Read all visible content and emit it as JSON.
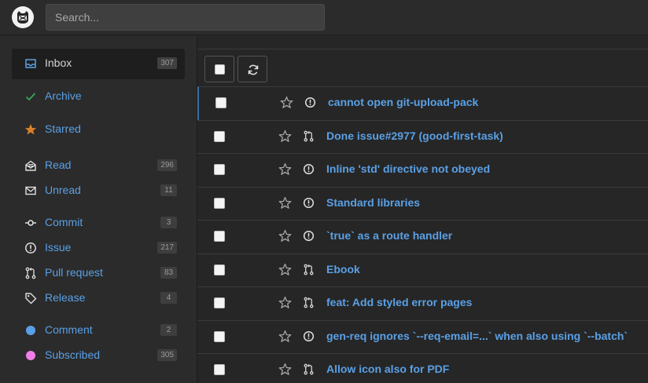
{
  "header": {
    "search_placeholder": "Search..."
  },
  "sidebar": {
    "items": [
      {
        "label": "Inbox",
        "count": "307",
        "icon": "inbox-icon"
      },
      {
        "label": "Archive",
        "count": "",
        "icon": "check-icon"
      },
      {
        "label": "Starred",
        "count": "",
        "icon": "star-icon"
      },
      {
        "label": "Read",
        "count": "296",
        "icon": "envelope-open-icon"
      },
      {
        "label": "Unread",
        "count": "11",
        "icon": "envelope-icon"
      },
      {
        "label": "Commit",
        "count": "3",
        "icon": "commit-icon"
      },
      {
        "label": "Issue",
        "count": "217",
        "icon": "issue-icon"
      },
      {
        "label": "Pull request",
        "count": "83",
        "icon": "pull-request-icon"
      },
      {
        "label": "Release",
        "count": "4",
        "icon": "tag-icon"
      },
      {
        "label": "Comment",
        "count": "2",
        "icon": "comment-dot-icon"
      },
      {
        "label": "Subscribed",
        "count": "305",
        "icon": "subscribed-dot-icon"
      }
    ]
  },
  "colors": {
    "accent": "#5aa0e6",
    "archive_green": "#3aa55a",
    "starred_orange": "#d9822b",
    "comment_blue": "#5aa0e6",
    "subscribed_pink": "#f07ee8"
  },
  "notifications": [
    {
      "title": "cannot open git-upload-pack",
      "type": "issue"
    },
    {
      "title": "Done issue#2977 (good-first-task)",
      "type": "pull-request"
    },
    {
      "title": "Inline 'std' directive not obeyed",
      "type": "issue"
    },
    {
      "title": "Standard libraries",
      "type": "issue"
    },
    {
      "title": "`true` as a route handler",
      "type": "issue"
    },
    {
      "title": "Ebook",
      "type": "pull-request"
    },
    {
      "title": "feat: Add styled error pages",
      "type": "pull-request"
    },
    {
      "title": "gen-req ignores `--req-email=...` when also using `--batch`",
      "type": "issue"
    },
    {
      "title": "Allow icon also for PDF",
      "type": "pull-request"
    }
  ]
}
